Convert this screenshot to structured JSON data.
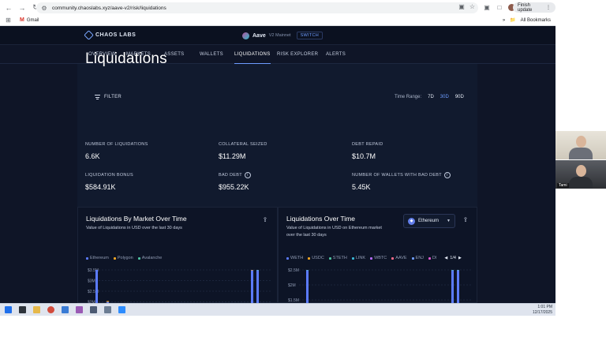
{
  "browser": {
    "url": "community.chaoslabs.xyz/aave-v2/risk/liquidations",
    "finish_update": "Finish update",
    "bookmark_gmail": "Gmail",
    "all_bookmarks": "All Bookmarks",
    "profile_initial": "G"
  },
  "header": {
    "logo_text": "CHAOS LABS",
    "protocol_name": "Aave",
    "protocol_market": "V2 Mainnet",
    "switch_label": "SWITCH"
  },
  "nav": {
    "items": [
      {
        "label": "OVERVIEW"
      },
      {
        "label": "MARKETS"
      },
      {
        "label": "ASSETS"
      },
      {
        "label": "WALLETS"
      },
      {
        "label": "LIQUIDATIONS"
      },
      {
        "label": "RISK EXPLORER"
      },
      {
        "label": "ALERTS"
      }
    ],
    "active": "LIQUIDATIONS"
  },
  "page": {
    "title": "Liquidations",
    "filter_label": "FILTER",
    "time_range_label": "Time Range:",
    "time_range_options": [
      "7D",
      "30D",
      "90D"
    ],
    "time_range_selected": "30D"
  },
  "stats": [
    {
      "label": "NUMBER OF LIQUIDATIONS",
      "value": "6.6K"
    },
    {
      "label": "COLLATERAL SEIZED",
      "value": "$11.29M"
    },
    {
      "label": "DEBT REPAID",
      "value": "$10.7M"
    },
    {
      "label": "LIQUIDATION BONUS",
      "value": "$584.91K"
    },
    {
      "label": "BAD DEBT",
      "value": "$955.22K"
    },
    {
      "label": "NUMBER OF WALLETS WITH BAD DEBT",
      "value": "5.45K"
    }
  ],
  "cards": {
    "by_market": {
      "title": "Liquidations By Market Over Time",
      "subtitle": "Value of Liquidations in USD over the last 30 days",
      "legend": [
        {
          "name": "Ethereum",
          "color": "#5b7bff"
        },
        {
          "name": "Polygon",
          "color": "#f5a623"
        },
        {
          "name": "Avalanche",
          "color": "#4fc3a1"
        }
      ]
    },
    "over_time": {
      "title": "Liquidations Over Time",
      "subtitle_line1": "Value of Liquidations in USD on Ethereum market",
      "subtitle_line2": "over the last 30 days",
      "select_value": "Ethereum",
      "legend": [
        {
          "name": "WETH",
          "color": "#5b7bff"
        },
        {
          "name": "USDC",
          "color": "#f5a623"
        },
        {
          "name": "STETH",
          "color": "#4fc3a1"
        },
        {
          "name": "LINK",
          "color": "#39b8d6"
        },
        {
          "name": "WBTC",
          "color": "#b56bff"
        },
        {
          "name": "AAVE",
          "color": "#ff6b8a"
        },
        {
          "name": "ENJ",
          "color": "#6d9cff"
        },
        {
          "name": "DI",
          "color": "#e05bd0"
        }
      ],
      "pager": "1/4"
    }
  },
  "chart_data": [
    {
      "type": "bar",
      "title": "Liquidations By Market Over Time",
      "ylabel_ticks": [
        "$3.5M",
        "$3M",
        "$2.5M",
        "$2M"
      ],
      "series": [
        {
          "name": "Ethereum",
          "values": [
            1.9,
            0.1,
            2.1,
            3.0
          ]
        },
        {
          "name": "Polygon",
          "values": [
            0.0,
            0.05,
            0.1,
            0.3
          ]
        },
        {
          "name": "Avalanche",
          "values": [
            0.0,
            0.0,
            0.0,
            0.05
          ]
        }
      ],
      "ylim": [
        1.8,
        3.6
      ]
    },
    {
      "type": "bar",
      "title": "Liquidations Over Time",
      "ylabel_ticks": [
        "$2.5M",
        "$2M",
        "$1.5M"
      ],
      "series": [
        {
          "name": "WETH",
          "values": [
            1.9,
            2.0,
            1.4
          ]
        },
        {
          "name": "USDC",
          "values": [
            0.1,
            0.05,
            0.1
          ]
        },
        {
          "name": "STETH",
          "values": [
            0.05,
            0.1,
            0.02
          ]
        }
      ],
      "ylim": [
        1.4,
        2.6
      ]
    }
  ],
  "taskbar": {
    "time": "1:01 PM",
    "date": "12/17/2025"
  },
  "video": {
    "participant2_name": "Tami"
  }
}
